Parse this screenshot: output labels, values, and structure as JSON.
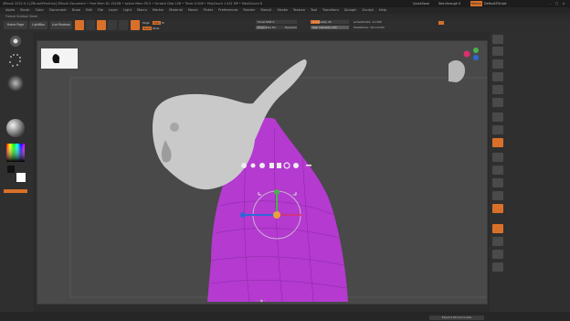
{
  "titlebar": {
    "text": "ZBrush 2022.0.1 [ZBrushPrimitive]   ZBrush Document   • Free Mem 81.152GB • Active Mem 59.5 • Scratch Disk 106 • Timer 0.006 • PolyCount 1.431 MP • MeshCount 8",
    "quicksave": "QuickSave",
    "see_through": "See-through 0",
    "menus": "Menus",
    "default_zscript": "DefaultZScript"
  },
  "menubar": {
    "items": [
      "Alpha",
      "Brush",
      "Color",
      "Document",
      "Draw",
      "Edit",
      "File",
      "Layer",
      "Light",
      "Macro",
      "Marker",
      "Material",
      "Movie",
      "Picker",
      "Preferences",
      "Render",
      "Stencil",
      "Stroke",
      "Texture",
      "Tool",
      "Transform",
      "Zplugin",
      "Zscript",
      "Help"
    ]
  },
  "subtool_label": "Freeze Subtool Sleek",
  "toolbar": {
    "home_page": "Home Page",
    "lightbox": "LightBox",
    "live_boolean": "Live Boolean",
    "edit": "Edit",
    "draw": "Draw",
    "move": "Move",
    "scale": "Scale",
    "rotate": "Rotate",
    "mrgb": "Mrgb",
    "rgb": "Rgb",
    "m": "M",
    "zadd": "Zadd",
    "zsub": "Zsub",
    "focal_shift": "Focal Shift 0",
    "draw_size": "Draw Size 64",
    "dynamic": "Dynamic",
    "z_intensity": "Z Intensity 25",
    "rgb_intensity": "Rgb Intensity 100",
    "active_points": "ActivePoints: 11.395",
    "total_points": "TotalPoints: 39.170 Mil"
  },
  "canvas": {
    "head_color": "#c9c9c9",
    "body_color": "#b43ad0"
  },
  "bottom": {
    "tab": "Expand Zbrush Guide"
  }
}
